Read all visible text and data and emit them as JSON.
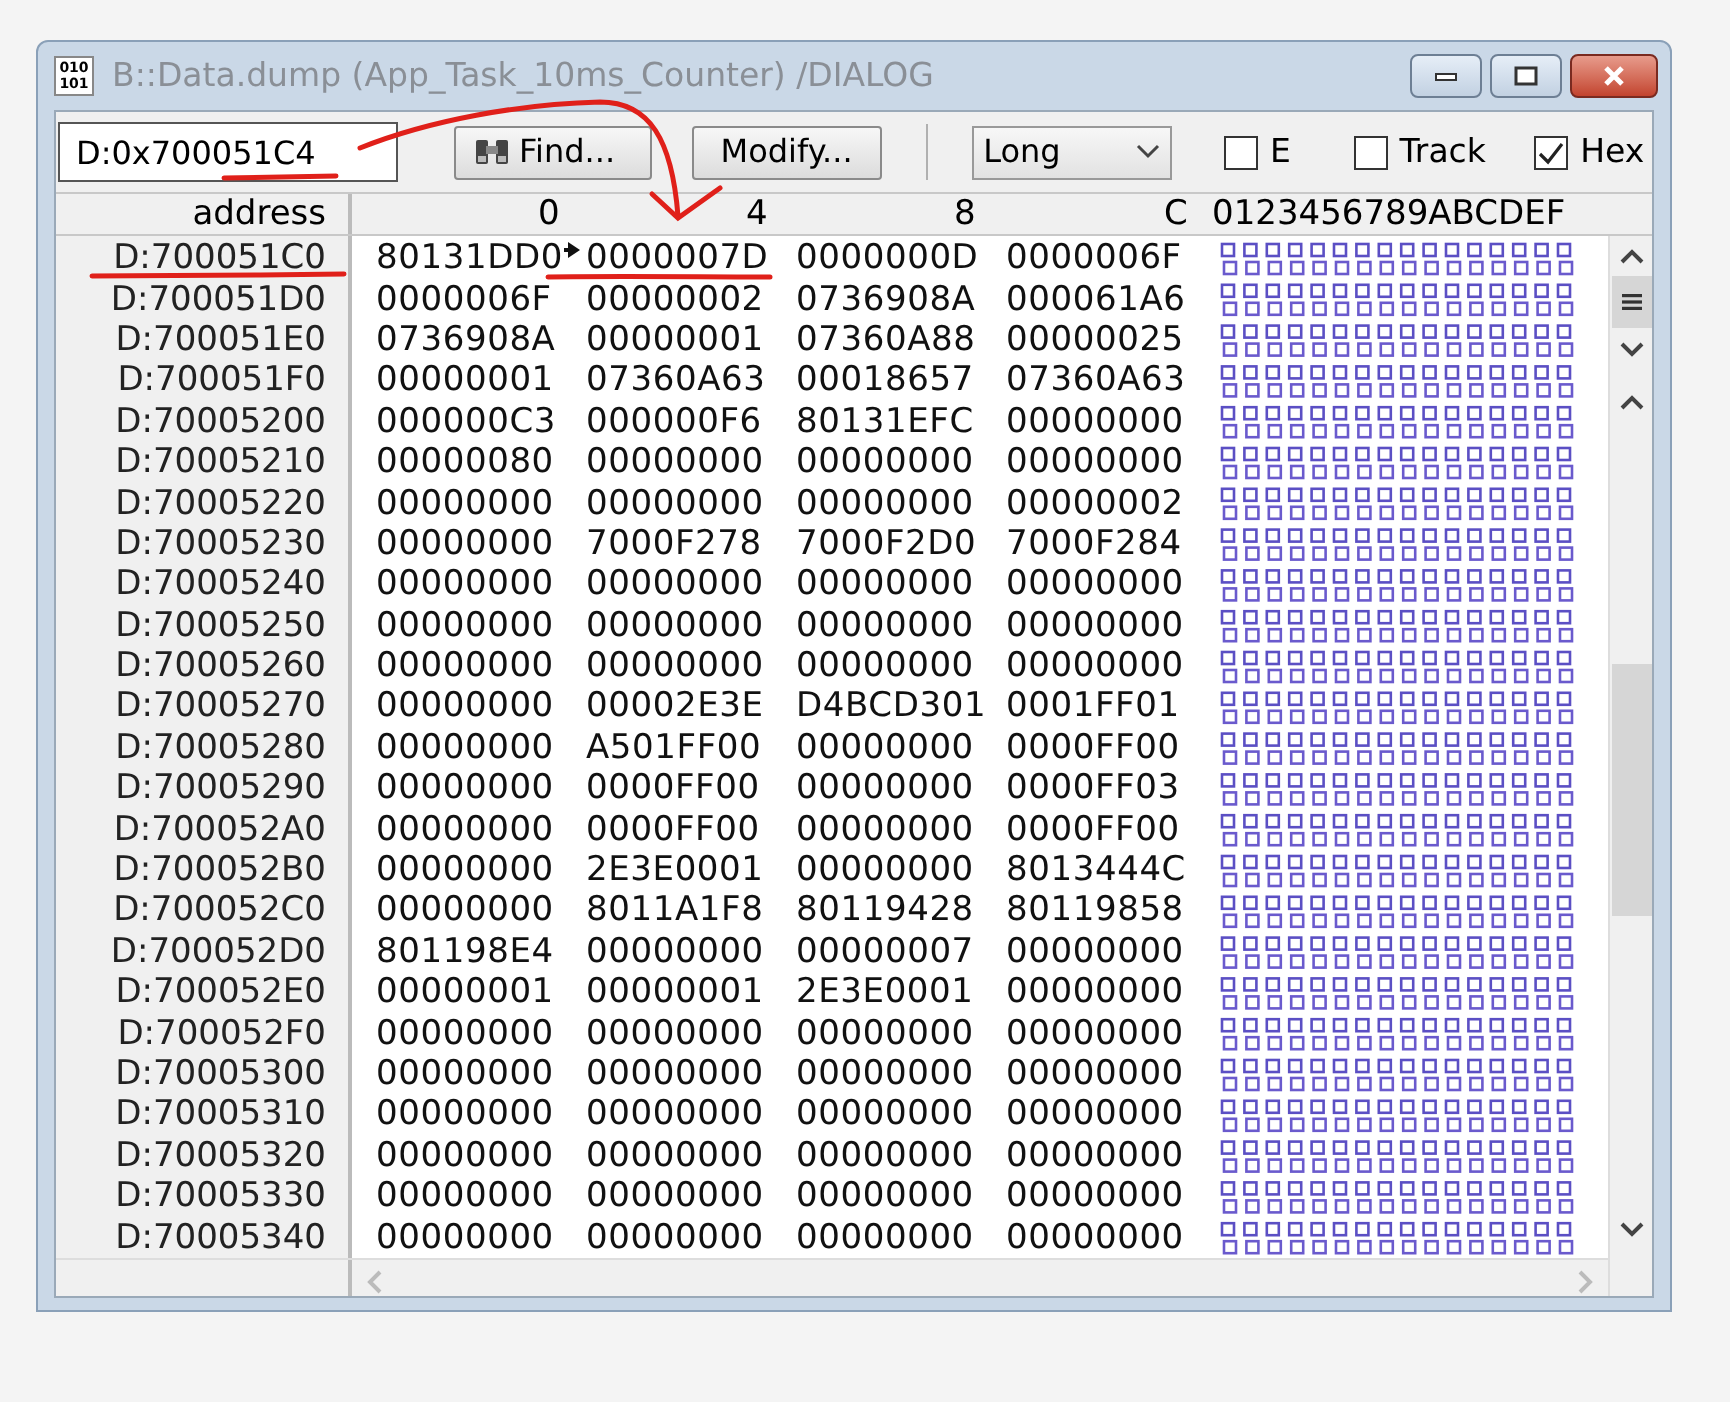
{
  "window": {
    "icon_text": [
      "010",
      "101"
    ],
    "title": "B::Data.dump (App_Task_10ms_Counter) /DIALOG"
  },
  "toolbar": {
    "address_field": {
      "value": "D:0x700051C4"
    },
    "buttons": [
      "Find...",
      "Modify..."
    ],
    "format": {
      "value": "Long"
    },
    "checkboxes": [
      {
        "label": "E",
        "checked": false
      },
      {
        "label": "Track",
        "checked": false
      },
      {
        "label": "Hex",
        "checked": true
      }
    ]
  },
  "columns": {
    "address": "address",
    "offsets": [
      "0",
      "4",
      "8",
      "C"
    ],
    "ascii": "0123456789ABCDEF"
  },
  "rows": [
    {
      "address": "D:700051C0",
      "values": [
        "80131DD0",
        "0000007D",
        "0000000D",
        "0000006F"
      ]
    },
    {
      "address": "D:700051D0",
      "values": [
        "0000006F",
        "00000002",
        "0736908A",
        "000061A6"
      ]
    },
    {
      "address": "D:700051E0",
      "values": [
        "0736908A",
        "00000001",
        "07360A88",
        "00000025"
      ]
    },
    {
      "address": "D:700051F0",
      "values": [
        "00000001",
        "07360A63",
        "00018657",
        "07360A63"
      ]
    },
    {
      "address": "D:70005200",
      "values": [
        "000000C3",
        "000000F6",
        "80131EFC",
        "00000000"
      ]
    },
    {
      "address": "D:70005210",
      "values": [
        "00000080",
        "00000000",
        "00000000",
        "00000000"
      ]
    },
    {
      "address": "D:70005220",
      "values": [
        "00000000",
        "00000000",
        "00000000",
        "00000002"
      ]
    },
    {
      "address": "D:70005230",
      "values": [
        "00000000",
        "7000F278",
        "7000F2D0",
        "7000F284"
      ]
    },
    {
      "address": "D:70005240",
      "values": [
        "00000000",
        "00000000",
        "00000000",
        "00000000"
      ]
    },
    {
      "address": "D:70005250",
      "values": [
        "00000000",
        "00000000",
        "00000000",
        "00000000"
      ]
    },
    {
      "address": "D:70005260",
      "values": [
        "00000000",
        "00000000",
        "00000000",
        "00000000"
      ]
    },
    {
      "address": "D:70005270",
      "values": [
        "00000000",
        "00002E3E",
        "D4BCD301",
        "0001FF01"
      ]
    },
    {
      "address": "D:70005280",
      "values": [
        "00000000",
        "A501FF00",
        "00000000",
        "0000FF00"
      ]
    },
    {
      "address": "D:70005290",
      "values": [
        "00000000",
        "0000FF00",
        "00000000",
        "0000FF03"
      ]
    },
    {
      "address": "D:700052A0",
      "values": [
        "00000000",
        "0000FF00",
        "00000000",
        "0000FF00"
      ]
    },
    {
      "address": "D:700052B0",
      "values": [
        "00000000",
        "2E3E0001",
        "00000000",
        "8013444C"
      ]
    },
    {
      "address": "D:700052C0",
      "values": [
        "00000000",
        "8011A1F8",
        "80119428",
        "80119858"
      ]
    },
    {
      "address": "D:700052D0",
      "values": [
        "801198E4",
        "00000000",
        "00000007",
        "00000000"
      ]
    },
    {
      "address": "D:700052E0",
      "values": [
        "00000001",
        "00000001",
        "2E3E0001",
        "00000000"
      ]
    },
    {
      "address": "D:700052F0",
      "values": [
        "00000000",
        "00000000",
        "00000000",
        "00000000"
      ]
    },
    {
      "address": "D:70005300",
      "values": [
        "00000000",
        "00000000",
        "00000000",
        "00000000"
      ]
    },
    {
      "address": "D:70005310",
      "values": [
        "00000000",
        "00000000",
        "00000000",
        "00000000"
      ]
    },
    {
      "address": "D:70005320",
      "values": [
        "00000000",
        "00000000",
        "00000000",
        "00000000"
      ]
    },
    {
      "address": "D:70005330",
      "values": [
        "00000000",
        "00000000",
        "00000000",
        "00000000"
      ]
    },
    {
      "address": "D:70005340",
      "values": [
        "00000000",
        "00000000",
        "00000000",
        "00000000"
      ]
    }
  ]
}
